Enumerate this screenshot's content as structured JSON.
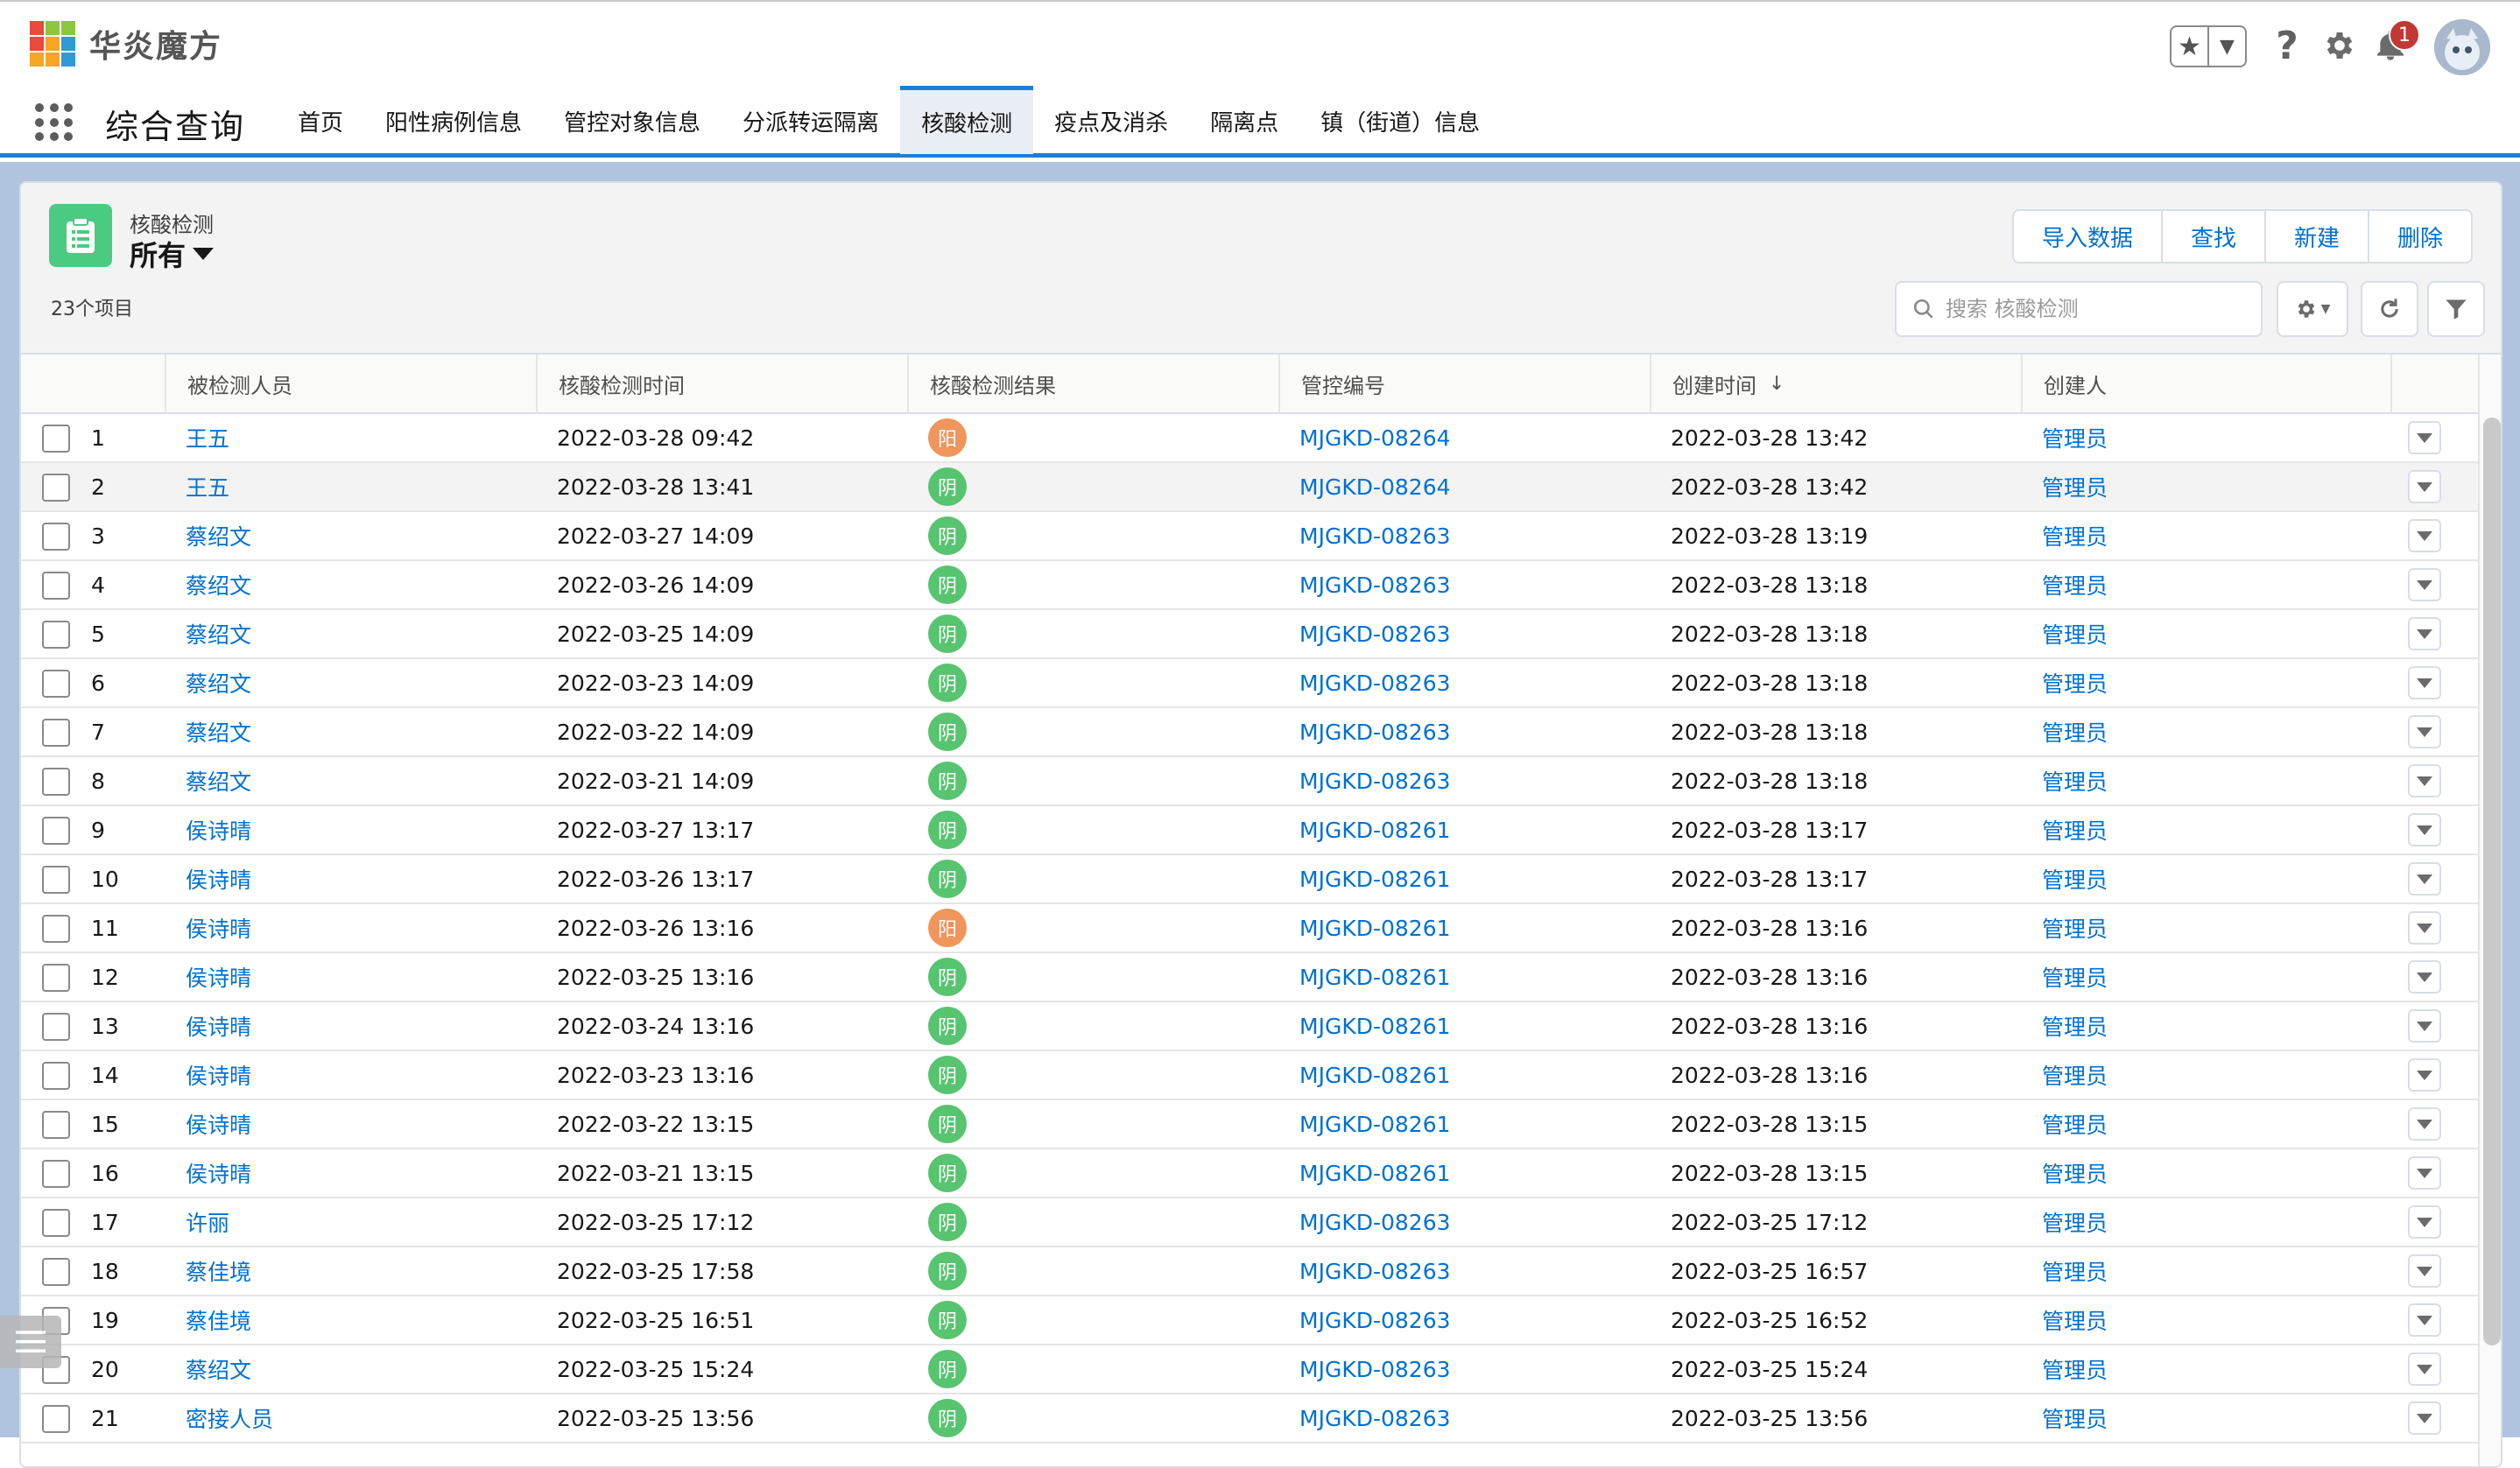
{
  "brand": {
    "name": "华炎魔方"
  },
  "header": {
    "notification_count": "1"
  },
  "app": {
    "name": "综合查询",
    "tabs": [
      "首页",
      "阳性病例信息",
      "管控对象信息",
      "分派转运隔离",
      "核酸检测",
      "疫点及消杀",
      "隔离点",
      "镇（街道）信息"
    ],
    "active_tab": "核酸检测"
  },
  "list_view": {
    "object_label": "核酸检测",
    "view_name": "所有",
    "item_count": "23个项目",
    "buttons": [
      "导入数据",
      "查找",
      "新建",
      "删除"
    ],
    "search_placeholder": "搜索 核酸检测"
  },
  "table": {
    "columns": [
      "被检测人员",
      "核酸检测时间",
      "核酸检测结果",
      "管控编号",
      "创建时间",
      "创建人"
    ],
    "sorted_column": "创建时间",
    "rows": [
      {
        "num": "1",
        "person": "王五",
        "test_time": "2022-03-28 09:42",
        "result": "阳",
        "result_color": "#f0955c",
        "code": "MJGKD-08264",
        "created": "2022-03-28 13:42",
        "creator": "管理员"
      },
      {
        "num": "2",
        "person": "王五",
        "test_time": "2022-03-28 13:41",
        "result": "阴",
        "result_color": "#57c46f",
        "code": "MJGKD-08264",
        "created": "2022-03-28 13:42",
        "creator": "管理员"
      },
      {
        "num": "3",
        "person": "蔡绍文",
        "test_time": "2022-03-27 14:09",
        "result": "阴",
        "result_color": "#57c46f",
        "code": "MJGKD-08263",
        "created": "2022-03-28 13:19",
        "creator": "管理员"
      },
      {
        "num": "4",
        "person": "蔡绍文",
        "test_time": "2022-03-26 14:09",
        "result": "阴",
        "result_color": "#57c46f",
        "code": "MJGKD-08263",
        "created": "2022-03-28 13:18",
        "creator": "管理员"
      },
      {
        "num": "5",
        "person": "蔡绍文",
        "test_time": "2022-03-25 14:09",
        "result": "阴",
        "result_color": "#57c46f",
        "code": "MJGKD-08263",
        "created": "2022-03-28 13:18",
        "creator": "管理员"
      },
      {
        "num": "6",
        "person": "蔡绍文",
        "test_time": "2022-03-23 14:09",
        "result": "阴",
        "result_color": "#57c46f",
        "code": "MJGKD-08263",
        "created": "2022-03-28 13:18",
        "creator": "管理员"
      },
      {
        "num": "7",
        "person": "蔡绍文",
        "test_time": "2022-03-22 14:09",
        "result": "阴",
        "result_color": "#57c46f",
        "code": "MJGKD-08263",
        "created": "2022-03-28 13:18",
        "creator": "管理员"
      },
      {
        "num": "8",
        "person": "蔡绍文",
        "test_time": "2022-03-21 14:09",
        "result": "阴",
        "result_color": "#57c46f",
        "code": "MJGKD-08263",
        "created": "2022-03-28 13:18",
        "creator": "管理员"
      },
      {
        "num": "9",
        "person": "侯诗晴",
        "test_time": "2022-03-27 13:17",
        "result": "阴",
        "result_color": "#57c46f",
        "code": "MJGKD-08261",
        "created": "2022-03-28 13:17",
        "creator": "管理员"
      },
      {
        "num": "10",
        "person": "侯诗晴",
        "test_time": "2022-03-26 13:17",
        "result": "阴",
        "result_color": "#57c46f",
        "code": "MJGKD-08261",
        "created": "2022-03-28 13:17",
        "creator": "管理员"
      },
      {
        "num": "11",
        "person": "侯诗晴",
        "test_time": "2022-03-26 13:16",
        "result": "阳",
        "result_color": "#f0955c",
        "code": "MJGKD-08261",
        "created": "2022-03-28 13:16",
        "creator": "管理员"
      },
      {
        "num": "12",
        "person": "侯诗晴",
        "test_time": "2022-03-25 13:16",
        "result": "阴",
        "result_color": "#57c46f",
        "code": "MJGKD-08261",
        "created": "2022-03-28 13:16",
        "creator": "管理员"
      },
      {
        "num": "13",
        "person": "侯诗晴",
        "test_time": "2022-03-24 13:16",
        "result": "阴",
        "result_color": "#57c46f",
        "code": "MJGKD-08261",
        "created": "2022-03-28 13:16",
        "creator": "管理员"
      },
      {
        "num": "14",
        "person": "侯诗晴",
        "test_time": "2022-03-23 13:16",
        "result": "阴",
        "result_color": "#57c46f",
        "code": "MJGKD-08261",
        "created": "2022-03-28 13:16",
        "creator": "管理员"
      },
      {
        "num": "15",
        "person": "侯诗晴",
        "test_time": "2022-03-22 13:15",
        "result": "阴",
        "result_color": "#57c46f",
        "code": "MJGKD-08261",
        "created": "2022-03-28 13:15",
        "creator": "管理员"
      },
      {
        "num": "16",
        "person": "侯诗晴",
        "test_time": "2022-03-21 13:15",
        "result": "阴",
        "result_color": "#57c46f",
        "code": "MJGKD-08261",
        "created": "2022-03-28 13:15",
        "creator": "管理员"
      },
      {
        "num": "17",
        "person": "许丽",
        "test_time": "2022-03-25 17:12",
        "result": "阴",
        "result_color": "#57c46f",
        "code": "MJGKD-08263",
        "created": "2022-03-25 17:12",
        "creator": "管理员"
      },
      {
        "num": "18",
        "person": "蔡佳境",
        "test_time": "2022-03-25 17:58",
        "result": "阴",
        "result_color": "#57c46f",
        "code": "MJGKD-08263",
        "created": "2022-03-25 16:57",
        "creator": "管理员"
      },
      {
        "num": "19",
        "person": "蔡佳境",
        "test_time": "2022-03-25 16:51",
        "result": "阴",
        "result_color": "#57c46f",
        "code": "MJGKD-08263",
        "created": "2022-03-25 16:52",
        "creator": "管理员"
      },
      {
        "num": "20",
        "person": "蔡绍文",
        "test_time": "2022-03-25 15:24",
        "result": "阴",
        "result_color": "#57c46f",
        "code": "MJGKD-08263",
        "created": "2022-03-25 15:24",
        "creator": "管理员"
      },
      {
        "num": "21",
        "person": "密接人员",
        "test_time": "2022-03-25 13:56",
        "result": "阴",
        "result_color": "#57c46f",
        "code": "MJGKD-08263",
        "created": "2022-03-25 13:56",
        "creator": "管理员"
      }
    ]
  },
  "colors": {
    "accent": "#1b7fd7",
    "link": "#0070d2",
    "negative": "#57c46f",
    "positive": "#f0955c",
    "object_icon": "#4bca81"
  },
  "icons": [
    "brand-logo",
    "favorite-star-icon",
    "question-icon",
    "gear-icon",
    "bell-icon",
    "avatar",
    "app-launcher-icon",
    "clipboard-icon",
    "search-icon",
    "refresh-icon",
    "filter-icon"
  ]
}
